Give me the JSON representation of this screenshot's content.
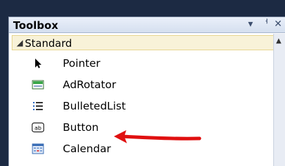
{
  "window": {
    "title": "Toolbox",
    "controls": [
      "▾",
      "ᅥ",
      "✕"
    ]
  },
  "section": {
    "label": "Standard",
    "caret": "◢"
  },
  "items": [
    {
      "label": "Pointer",
      "icon": "pointer-icon"
    },
    {
      "label": "AdRotator",
      "icon": "adrotator-icon"
    },
    {
      "label": "BulletedList",
      "icon": "bulletedlist-icon"
    },
    {
      "label": "Button",
      "icon": "button-icon"
    },
    {
      "label": "Calendar",
      "icon": "calendar-icon"
    }
  ],
  "scrollbar": {
    "up_arrow": "▲"
  },
  "annotation": {
    "arrow_color": "#e01010"
  }
}
